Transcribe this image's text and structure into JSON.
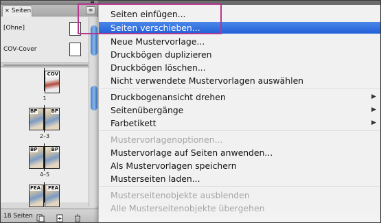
{
  "panel": {
    "tab_label": "Seiten",
    "masters": [
      {
        "label": "[Ohne]"
      },
      {
        "label": "COV-Cover"
      }
    ],
    "pages": [
      {
        "label": "1",
        "markers": [
          "COV"
        ]
      },
      {
        "label": "2–3",
        "markers": [
          "BP",
          "BP"
        ]
      },
      {
        "label": "4–5",
        "markers": [
          "BP",
          "BP"
        ]
      },
      {
        "label": "",
        "markers": [
          "FEA",
          "FEA"
        ]
      }
    ],
    "footer_text": "18 Seiten"
  },
  "menu": {
    "items": [
      {
        "label": "Seiten einfügen...",
        "state": "normal"
      },
      {
        "label": "Seiten verschieben...",
        "state": "highlighted"
      },
      {
        "label": "Neue Mustervorlage...",
        "state": "normal"
      },
      {
        "label": "Druckbögen duplizieren",
        "state": "normal"
      },
      {
        "label": "Druckbögen löschen...",
        "state": "normal"
      },
      {
        "label": "Nicht verwendete Mustervorlagen auswählen",
        "state": "normal"
      },
      {
        "label": "Druckbogenansicht drehen",
        "state": "submenu"
      },
      {
        "label": "Seitenübergänge",
        "state": "submenu"
      },
      {
        "label": "Farbetikett",
        "state": "submenu"
      },
      {
        "label": "Mustervorlagenoptionen...",
        "state": "disabled"
      },
      {
        "label": "Mustervorlage auf Seiten anwenden...",
        "state": "normal"
      },
      {
        "label": "Als Mustervorlagen speichern",
        "state": "normal"
      },
      {
        "label": "Musterseiten laden...",
        "state": "normal"
      },
      {
        "label": "Musterseitenobjekte ausblenden",
        "state": "disabled"
      },
      {
        "label": "Alle Musterseitenobjekte übergehen",
        "state": "disabled"
      }
    ]
  },
  "colors": {
    "highlight": "#2f6fdc",
    "annotation": "#b4378f",
    "scroll_thumb": "#3f7fd1"
  }
}
